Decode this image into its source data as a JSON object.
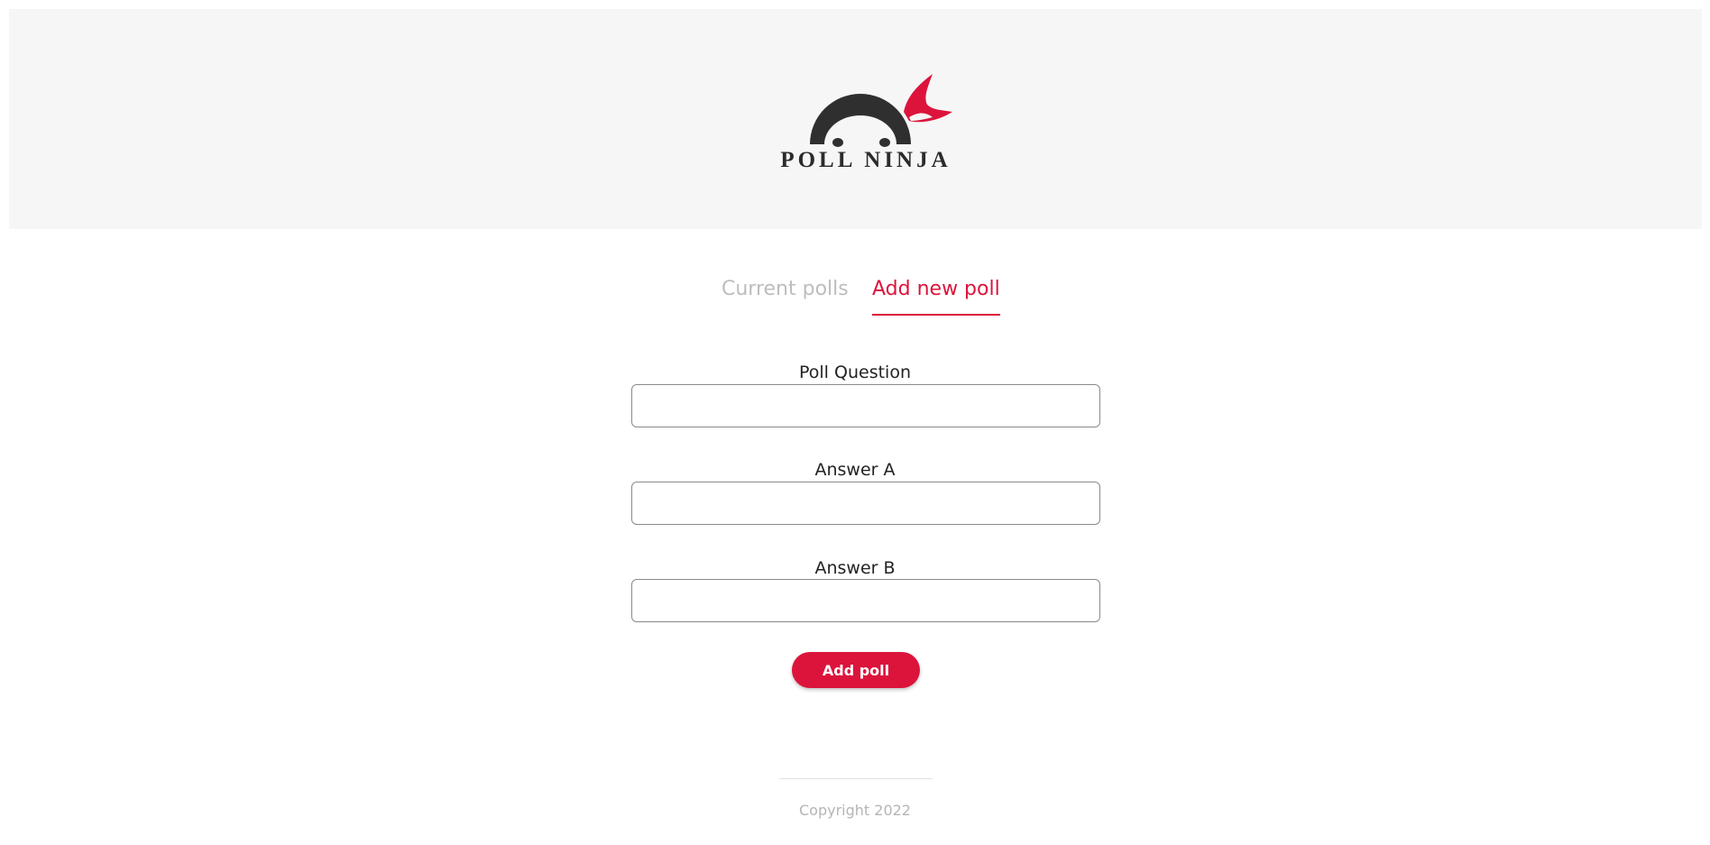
{
  "brand": {
    "name": "POLL NINJA",
    "accent_color": "#dc143c",
    "logo_icon": "ninja-head-icon"
  },
  "tabs": [
    {
      "label": "Current polls",
      "active": false
    },
    {
      "label": "Add new poll",
      "active": true
    }
  ],
  "form": {
    "question_label": "Poll Question",
    "question_value": "",
    "answer_a_label": "Answer A",
    "answer_a_value": "",
    "answer_b_label": "Answer B",
    "answer_b_value": "",
    "submit_label": "Add poll"
  },
  "footer": {
    "copyright": "Copyright 2022"
  }
}
